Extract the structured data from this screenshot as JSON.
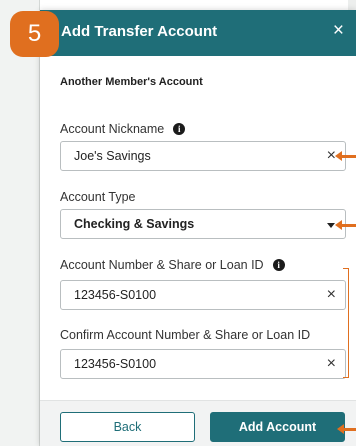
{
  "step_badge": "5",
  "modal": {
    "title": "Add Transfer Account",
    "close_glyph": "×"
  },
  "section_title": "Another Member's Account",
  "fields": {
    "nickname": {
      "label": "Account Nickname",
      "value": "Joe's Savings",
      "clear_glyph": "×"
    },
    "account_type": {
      "label": "Account Type",
      "value": "Checking & Savings"
    },
    "account_number": {
      "label": "Account Number & Share or Loan ID",
      "value": "123456-S0100",
      "clear_glyph": "×"
    },
    "confirm_account_number": {
      "label": "Confirm Account Number & Share or Loan ID",
      "value": "123456-S0100",
      "clear_glyph": "×"
    }
  },
  "info_glyph": "i",
  "buttons": {
    "back": "Back",
    "add_account": "Add Account"
  },
  "colors": {
    "primary": "#1f6e78",
    "annotation": "#e06f1f"
  },
  "icons": {
    "close": "close-icon",
    "info": "info-icon",
    "clear": "clear-icon",
    "dropdown": "chevron-down-icon"
  }
}
